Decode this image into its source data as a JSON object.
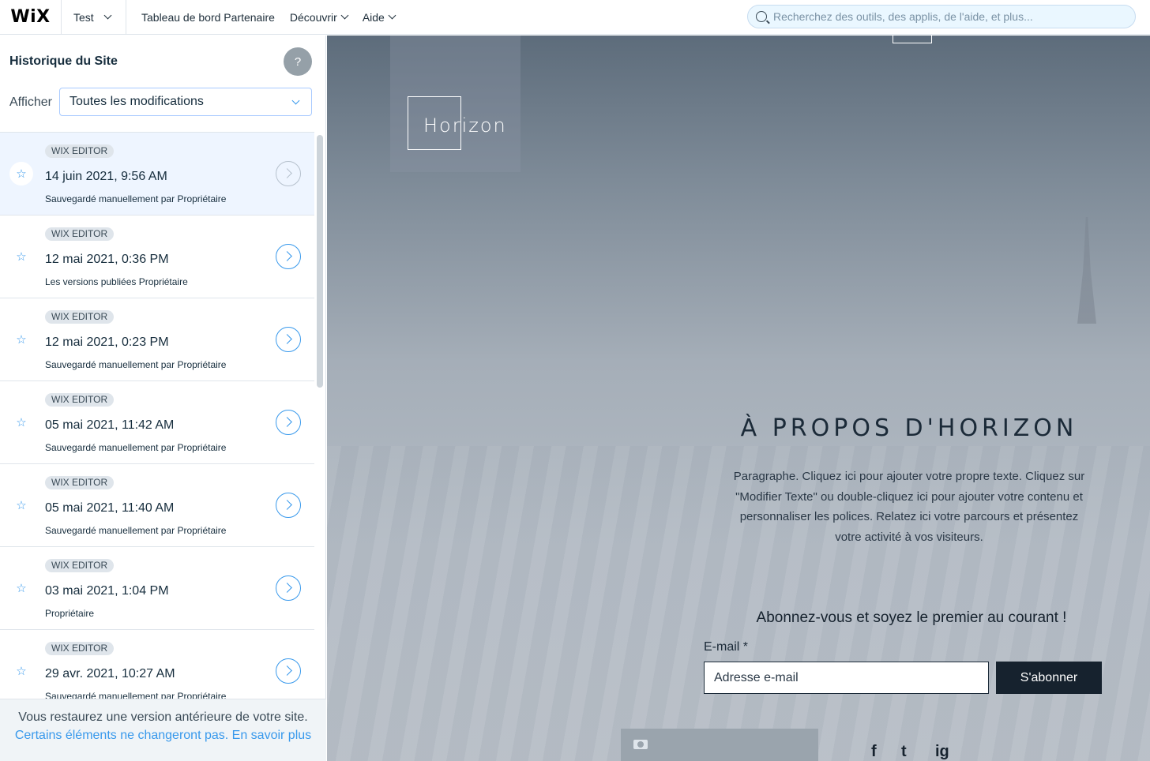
{
  "topbar": {
    "logo": "WiX",
    "site_name": "Test",
    "nav": [
      "Tableau de bord Partenaire",
      "Découvrir",
      "Aide"
    ],
    "search_placeholder": "Recherchez des outils, des applis, de l'aide, et plus..."
  },
  "panel": {
    "title": "Historique du Site",
    "help_label": "?",
    "filter_label": "Afficher",
    "filter_value": "Toutes les modifications",
    "items": [
      {
        "badge": "WIX EDITOR",
        "date": "14 juin 2021, 9:56 AM",
        "desc": "Sauvegardé manuellement par Propriétaire"
      },
      {
        "badge": "WIX EDITOR",
        "date": "12 mai 2021, 0:36 PM",
        "desc": "Les versions publiées Propriétaire"
      },
      {
        "badge": "WIX EDITOR",
        "date": "12 mai 2021, 0:23 PM",
        "desc": "Sauvegardé manuellement par Propriétaire"
      },
      {
        "badge": "WIX EDITOR",
        "date": "05 mai 2021, 11:42 AM",
        "desc": "Sauvegardé manuellement par Propriétaire"
      },
      {
        "badge": "WIX EDITOR",
        "date": "05 mai 2021, 11:40 AM",
        "desc": "Sauvegardé manuellement par Propriétaire"
      },
      {
        "badge": "WIX EDITOR",
        "date": "03 mai 2021, 1:04 PM",
        "desc": "Propriétaire"
      },
      {
        "badge": "WIX EDITOR",
        "date": "29 avr. 2021, 10:27 AM",
        "desc": "Sauvegardé manuellement par Propriétaire"
      }
    ],
    "footer_text": "Vous restaurez une version antérieure de votre site.",
    "footer_link": "Certains éléments ne changeront pas. En savoir plus"
  },
  "preview": {
    "logo_text": "Horizon",
    "about_title": "À PROPOS D'HORIZON",
    "about_text": "Paragraphe. Cliquez ici pour ajouter votre propre texte. Cliquez sur \"Modifier Texte\" ou double-cliquez ici pour ajouter votre contenu et personnaliser les polices. Relatez ici votre parcours et présentez votre activité à vos visiteurs.",
    "subscribe_title": "Abonnez-vous et soyez le premier au courant !",
    "email_label": "E-mail *",
    "email_placeholder": "Adresse e-mail",
    "subscribe_button": "S'abonner",
    "social": [
      "f",
      "t",
      "ig"
    ]
  },
  "colors": {
    "accent": "#3899ec",
    "selected_row": "#eef5ff",
    "dark_button": "#16222e"
  }
}
